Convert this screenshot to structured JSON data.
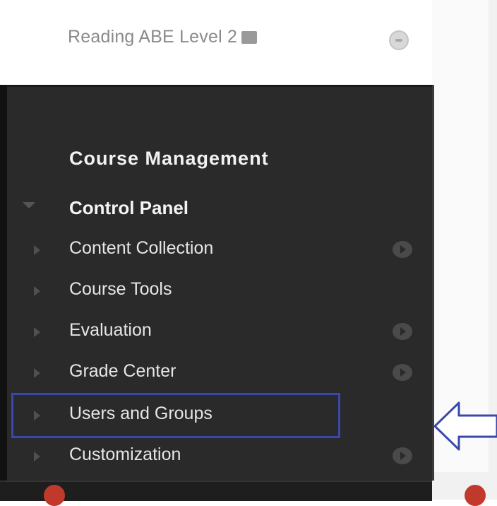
{
  "course": {
    "title": "Reading ABE Level 2"
  },
  "panel": {
    "heading": "Course Management",
    "control_panel_label": "Control Panel",
    "items": [
      {
        "label": "Content Collection",
        "has_arrow": true
      },
      {
        "label": "Course Tools",
        "has_arrow": false
      },
      {
        "label": "Evaluation",
        "has_arrow": true
      },
      {
        "label": "Grade Center",
        "has_arrow": true
      },
      {
        "label": "Users and Groups",
        "has_arrow": false,
        "highlighted": true
      },
      {
        "label": "Customization",
        "has_arrow": true
      }
    ]
  },
  "colors": {
    "panel_bg": "#2a2a2a",
    "highlight": "#3949ab",
    "text": "#e6e6e6"
  }
}
